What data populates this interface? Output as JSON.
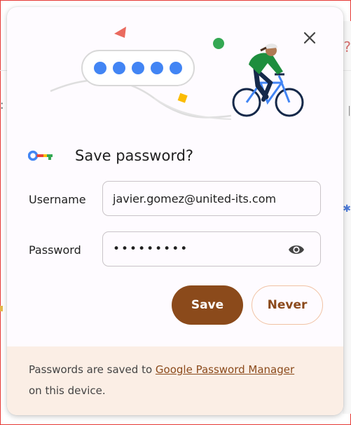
{
  "dialog": {
    "title": "Save password?",
    "close_icon": "close-icon",
    "key_icon": "key-icon",
    "username": {
      "label": "Username",
      "value": "javier.gomez@united-its.com"
    },
    "password": {
      "label": "Password",
      "masked_value": "•••••••••",
      "reveal_icon": "eye-icon"
    },
    "buttons": {
      "save": "Save",
      "never": "Never"
    },
    "footer": {
      "text_before": "Passwords are saved to ",
      "link": "Google Password Manager",
      "text_after": " on this device."
    },
    "illustration": {
      "masked_chars": 5
    }
  },
  "colors": {
    "accent": "#8b4a1b",
    "footer_bg": "#fbeee5",
    "dot_blue": "#4285f4",
    "frame_border": "#e53935"
  }
}
